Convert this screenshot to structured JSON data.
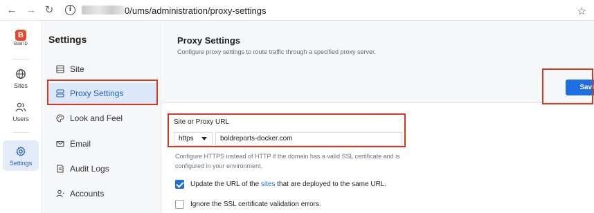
{
  "browser": {
    "back_icon": "←",
    "forward_icon": "→",
    "reload_icon": "↻",
    "url_path": "0/ums/administration/proxy-settings",
    "bookmark_icon": "☆"
  },
  "rail": {
    "logo_letter": "B",
    "logo_text": "Bold ID",
    "items": [
      {
        "label": "Sites",
        "icon": "globe-icon"
      },
      {
        "label": "Users",
        "icon": "users-icon"
      },
      {
        "label": "Settings",
        "icon": "gear-icon"
      }
    ]
  },
  "settings": {
    "title": "Settings",
    "menu": [
      {
        "label": "Site",
        "icon": "site-icon"
      },
      {
        "label": "Proxy Settings",
        "icon": "proxy-icon",
        "active": true
      },
      {
        "label": "Look and Feel",
        "icon": "palette-icon"
      },
      {
        "label": "Email",
        "icon": "mail-icon"
      },
      {
        "label": "Audit Logs",
        "icon": "audit-icon"
      },
      {
        "label": "Accounts",
        "icon": "accounts-icon"
      }
    ]
  },
  "main": {
    "title": "Proxy Settings",
    "subtitle": "Configure proxy settings to route traffic through a specified proxy server.",
    "save_label": "Save",
    "field_label": "Site or Proxy URL",
    "protocol_value": "https",
    "url_value": "boldreports-docker.com",
    "helper_text": "Configure HTTPS instead of HTTP if the domain has a valid SSL certificate and is configured in your environment.",
    "update_prefix": "Update the URL of the ",
    "update_link": "sites",
    "update_suffix": " that are deployed to the same URL.",
    "ignore_ssl_label": "Ignore the SSL certificate validation errors.",
    "update_checked": true,
    "ignore_checked": false
  },
  "colors": {
    "accent": "#1e6fe1",
    "highlight_border": "#d23b20",
    "brand": "#e8472a"
  }
}
